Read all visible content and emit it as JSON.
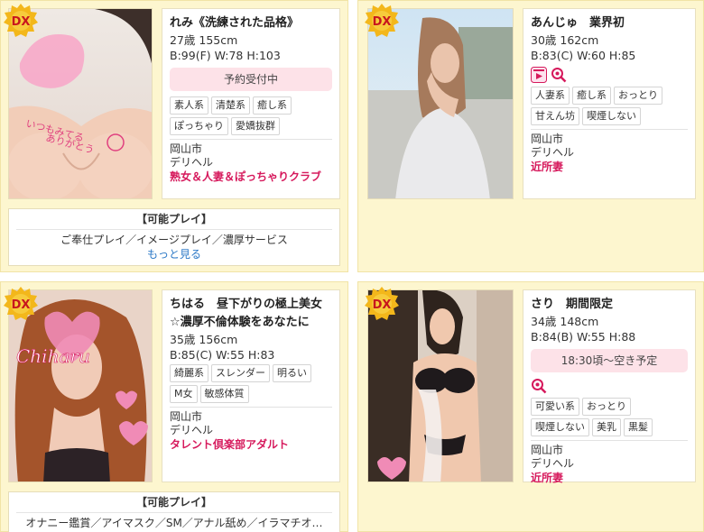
{
  "cards": [
    {
      "name": "れみ《洗練された品格》",
      "age_height": "27歳 155cm",
      "sizes": "B:99(F) W:78 H:103",
      "status": "予約受付中",
      "tags": [
        "素人系",
        "清楚系",
        "癒し系",
        "ぽっちゃり",
        "愛嬌抜群"
      ],
      "area": "岡山市",
      "genre": "デリヘル",
      "shop": "熟女＆人妻＆ぽっちゃりクラブ",
      "photo_text": "いつもみてる\nありがとう",
      "play_title": "【可能プレイ】",
      "play_list": "ご奉仕プレイ／イメージプレイ／濃厚サービス",
      "more": "もっと見る"
    },
    {
      "name": "あんじゅ　業界初",
      "age_height": "30歳 162cm",
      "sizes": "B:83(C) W:60 H:85",
      "icons": [
        "video-icon",
        "zoom-icon"
      ],
      "tags": [
        "人妻系",
        "癒し系",
        "おっとり",
        "甘えん坊",
        "喫煙しない"
      ],
      "area": "岡山市",
      "genre": "デリヘル",
      "shop": "近所妻"
    },
    {
      "name": "ちはる　昼下がりの極上美女☆濃厚不倫体験をあなたに",
      "age_height": "35歳 156cm",
      "sizes": "B:85(C) W:55 H:83",
      "tags": [
        "綺麗系",
        "スレンダー",
        "明るい",
        "M女",
        "敏感体質"
      ],
      "area": "岡山市",
      "genre": "デリヘル",
      "shop": "タレント倶楽部アダルト",
      "photo_text": "Chiharu",
      "play_title": "【可能プレイ】",
      "play_list": "オナニー鑑賞／アイマスク／SM／アナル舐め／イラマチオ…"
    },
    {
      "name": "さり　期間限定",
      "age_height": "34歳 148cm",
      "sizes": "B:84(B) W:55 H:88",
      "status": "18:30頃～空き予定",
      "icons": [
        "zoom-icon"
      ],
      "tags": [
        "可愛い系",
        "おっとり",
        "喫煙しない",
        "美乳",
        "黒髪"
      ],
      "area": "岡山市",
      "genre": "デリヘル",
      "shop": "近所妻"
    }
  ],
  "badge_label": "DX",
  "colors": {
    "shop": "#d6195c",
    "card_bg": "#fdf6cf",
    "status_bg": "#fde2e8",
    "badge": "#f3b71b",
    "link": "#2b78c6"
  }
}
